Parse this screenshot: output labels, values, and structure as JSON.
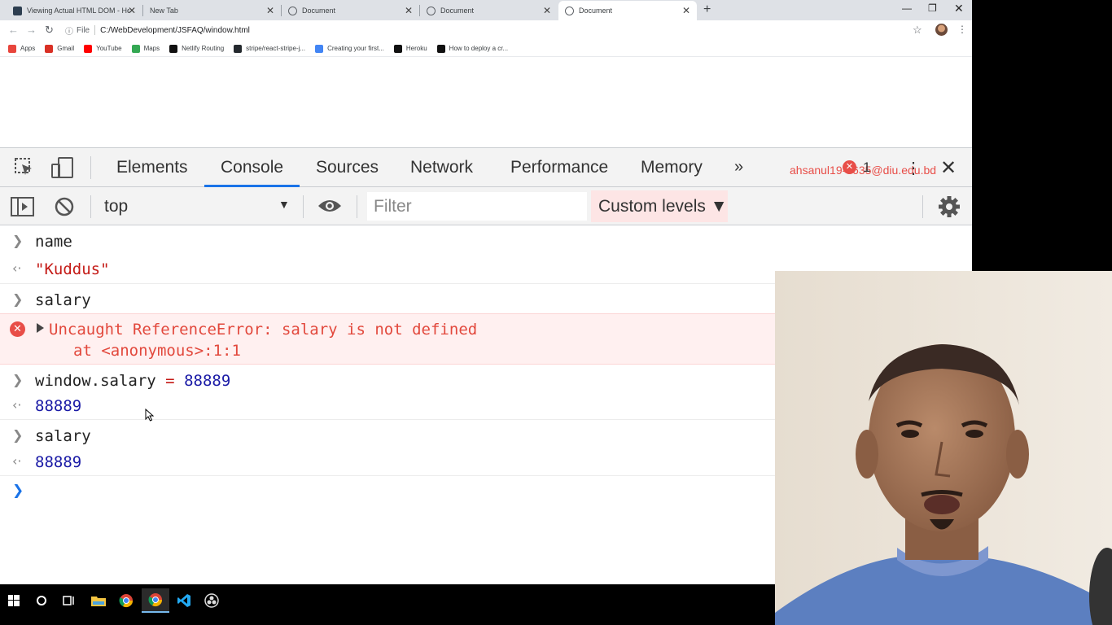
{
  "browser": {
    "tabs": [
      {
        "title": "Viewing Actual HTML DOM - Hel",
        "active": false
      },
      {
        "title": "New Tab",
        "active": false
      },
      {
        "title": "Document",
        "active": false
      },
      {
        "title": "Document",
        "active": false
      },
      {
        "title": "Document",
        "active": true
      }
    ],
    "address": {
      "scheme_label": "File",
      "url": "C:/WebDevelopment/JSFAQ/window.html"
    },
    "bookmarks": [
      {
        "label": "Apps",
        "icon": "apps-grid-icon",
        "color": "#e8453c"
      },
      {
        "label": "Gmail",
        "icon": "gmail-icon",
        "color": "#d93025"
      },
      {
        "label": "YouTube",
        "icon": "youtube-icon",
        "color": "#ff0000"
      },
      {
        "label": "Maps",
        "icon": "maps-icon",
        "color": "#34a853"
      },
      {
        "label": "Netlify Routing",
        "icon": "medium-icon",
        "color": "#111111"
      },
      {
        "label": "stripe/react-stripe-j...",
        "icon": "github-icon",
        "color": "#24292e"
      },
      {
        "label": "Creating your first...",
        "icon": "bookmark-page-icon",
        "color": "#4285f4"
      },
      {
        "label": "Heroku",
        "icon": "heroku-icon",
        "color": "#111111"
      },
      {
        "label": "How to deploy a cr...",
        "icon": "medium-icon",
        "color": "#111111"
      }
    ]
  },
  "devtools": {
    "tabs": [
      "Elements",
      "Console",
      "Sources",
      "Network",
      "Performance",
      "Memory"
    ],
    "active_tab": "Console",
    "account": "ahsanul19-8635@diu.edu.bd",
    "error_count": "1",
    "context": "top",
    "filter_placeholder": "Filter",
    "levels_label": "Custom levels ▼",
    "accent": "#1a73e8",
    "error_color": "#e84e48"
  },
  "console": {
    "lines": [
      {
        "kind": "input",
        "text": "name"
      },
      {
        "kind": "output-string",
        "text": "\"Kuddus\""
      },
      {
        "kind": "input",
        "text": "salary"
      },
      {
        "kind": "error",
        "text": "Uncaught ReferenceError: salary is not defined",
        "detail": "at <anonymous>:1:1"
      },
      {
        "kind": "input",
        "text_parts": [
          "window.salary",
          "=",
          "88889"
        ]
      },
      {
        "kind": "output-number",
        "text": "88889"
      },
      {
        "kind": "input",
        "text": "salary"
      },
      {
        "kind": "output-number",
        "text": "88889"
      }
    ]
  }
}
